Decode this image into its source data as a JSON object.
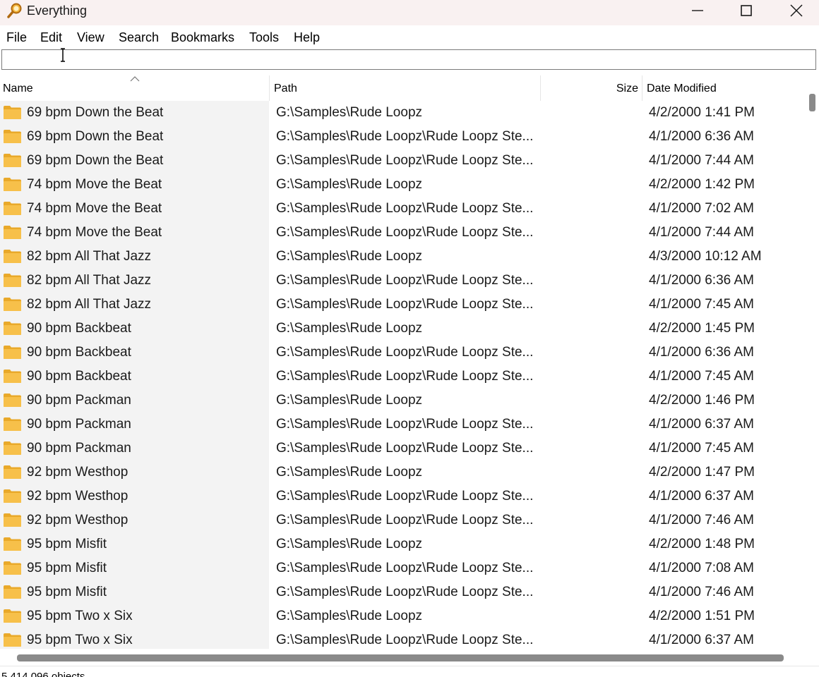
{
  "window": {
    "title": "Everything",
    "icon": "magnifier-icon",
    "controls": [
      "minimize-icon",
      "maximize-icon",
      "close-icon"
    ]
  },
  "menu": [
    "File",
    "Edit",
    "View",
    "Search",
    "Bookmarks",
    "Tools",
    "Help"
  ],
  "search": {
    "value": "",
    "placeholder": ""
  },
  "columns": {
    "name": "Name",
    "path": "Path",
    "size": "Size",
    "date": "Date Modified"
  },
  "sort": {
    "column": "Name",
    "direction": "ascending"
  },
  "rows": [
    {
      "name": "69 bpm Down the Beat",
      "path": "G:\\Samples\\Rude Loopz",
      "date": "4/2/2000 1:41 PM"
    },
    {
      "name": "69 bpm Down the Beat",
      "path": "G:\\Samples\\Rude Loopz\\Rude Loopz Ste...",
      "date": "4/1/2000 6:36 AM"
    },
    {
      "name": "69 bpm Down the Beat",
      "path": "G:\\Samples\\Rude Loopz\\Rude Loopz Ste...",
      "date": "4/1/2000 7:44 AM"
    },
    {
      "name": "74 bpm Move the Beat",
      "path": "G:\\Samples\\Rude Loopz",
      "date": "4/2/2000 1:42 PM"
    },
    {
      "name": "74 bpm Move the Beat",
      "path": "G:\\Samples\\Rude Loopz\\Rude Loopz Ste...",
      "date": "4/1/2000 7:02 AM"
    },
    {
      "name": "74 bpm Move the Beat",
      "path": "G:\\Samples\\Rude Loopz\\Rude Loopz Ste...",
      "date": "4/1/2000 7:44 AM"
    },
    {
      "name": "82 bpm All That Jazz",
      "path": "G:\\Samples\\Rude Loopz",
      "date": "4/3/2000 10:12 AM"
    },
    {
      "name": "82 bpm All That Jazz",
      "path": "G:\\Samples\\Rude Loopz\\Rude Loopz Ste...",
      "date": "4/1/2000 6:36 AM"
    },
    {
      "name": "82 bpm All That Jazz",
      "path": "G:\\Samples\\Rude Loopz\\Rude Loopz Ste...",
      "date": "4/1/2000 7:45 AM"
    },
    {
      "name": "90 bpm Backbeat",
      "path": "G:\\Samples\\Rude Loopz",
      "date": "4/2/2000 1:45 PM"
    },
    {
      "name": "90 bpm Backbeat",
      "path": "G:\\Samples\\Rude Loopz\\Rude Loopz Ste...",
      "date": "4/1/2000 6:36 AM"
    },
    {
      "name": "90 bpm Backbeat",
      "path": "G:\\Samples\\Rude Loopz\\Rude Loopz Ste...",
      "date": "4/1/2000 7:45 AM"
    },
    {
      "name": "90 bpm Packman",
      "path": "G:\\Samples\\Rude Loopz",
      "date": "4/2/2000 1:46 PM"
    },
    {
      "name": "90 bpm Packman",
      "path": "G:\\Samples\\Rude Loopz\\Rude Loopz Ste...",
      "date": "4/1/2000 6:37 AM"
    },
    {
      "name": "90 bpm Packman",
      "path": "G:\\Samples\\Rude Loopz\\Rude Loopz Ste...",
      "date": "4/1/2000 7:45 AM"
    },
    {
      "name": "92 bpm Westhop",
      "path": "G:\\Samples\\Rude Loopz",
      "date": "4/2/2000 1:47 PM"
    },
    {
      "name": "92 bpm Westhop",
      "path": "G:\\Samples\\Rude Loopz\\Rude Loopz Ste...",
      "date": "4/1/2000 6:37 AM"
    },
    {
      "name": "92 bpm Westhop",
      "path": "G:\\Samples\\Rude Loopz\\Rude Loopz Ste...",
      "date": "4/1/2000 7:46 AM"
    },
    {
      "name": "95 bpm Misfit",
      "path": "G:\\Samples\\Rude Loopz",
      "date": "4/2/2000 1:48 PM"
    },
    {
      "name": "95 bpm Misfit",
      "path": "G:\\Samples\\Rude Loopz\\Rude Loopz Ste...",
      "date": "4/1/2000 7:08 AM"
    },
    {
      "name": "95 bpm Misfit",
      "path": "G:\\Samples\\Rude Loopz\\Rude Loopz Ste...",
      "date": "4/1/2000 7:46 AM"
    },
    {
      "name": "95 bpm Two x Six",
      "path": "G:\\Samples\\Rude Loopz",
      "date": "4/2/2000 1:51 PM"
    },
    {
      "name": "95 bpm Two x Six",
      "path": "G:\\Samples\\Rude Loopz\\Rude Loopz Ste...",
      "date": "4/1/2000 6:37 AM"
    }
  ],
  "row_icon": "folder-icon",
  "status": "5,414,096 objects",
  "colors": {
    "titlebar": "#f9f1f1",
    "name_column": "#f3f3f3",
    "folder": "#f7c04a",
    "scrollbar_thumb": "#8a8a8a"
  }
}
